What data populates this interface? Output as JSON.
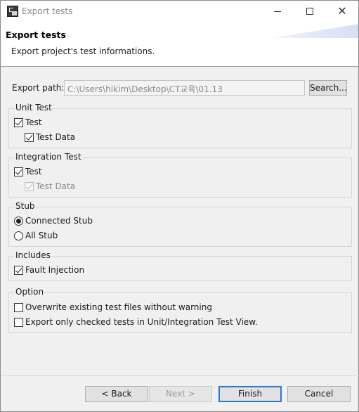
{
  "window": {
    "title": "Export tests",
    "controls": {
      "minimize_icon": "minimize-icon",
      "maximize_icon": "maximize-icon",
      "close_icon": "close-icon"
    }
  },
  "header": {
    "title": "Export tests",
    "description": "Export project's test informations."
  },
  "export_path": {
    "label": "Export path:",
    "value": "C:\\Users\\hikim\\Desktop\\CT교육\\01.13",
    "search_label": "Search..."
  },
  "groups": {
    "unit_test": {
      "title": "Unit Test",
      "test_label": "Test",
      "test_checked": true,
      "test_data_label": "Test Data",
      "test_data_checked": true
    },
    "integration_test": {
      "title": "Integration Test",
      "test_label": "Test",
      "test_checked": true,
      "test_data_label": "Test Data",
      "test_data_checked": true,
      "test_data_enabled": false
    },
    "stub": {
      "title": "Stub",
      "options": [
        "Connected Stub",
        "All Stub"
      ],
      "selected": "Connected Stub"
    },
    "includes": {
      "title": "Includes",
      "fault_injection_label": "Fault Injection",
      "fault_injection_checked": true
    },
    "option": {
      "title": "Option",
      "overwrite_label": "Overwrite existing test files without warning",
      "overwrite_checked": false,
      "export_checked_label": "Export only checked tests in Unit/Integration Test View.",
      "export_checked_checked": false
    }
  },
  "footer": {
    "back_label": "< Back",
    "next_label": "Next >",
    "finish_label": "Finish",
    "cancel_label": "Cancel"
  },
  "colors": {
    "accent": "#2a78d6",
    "background": "#f0f0f0"
  }
}
